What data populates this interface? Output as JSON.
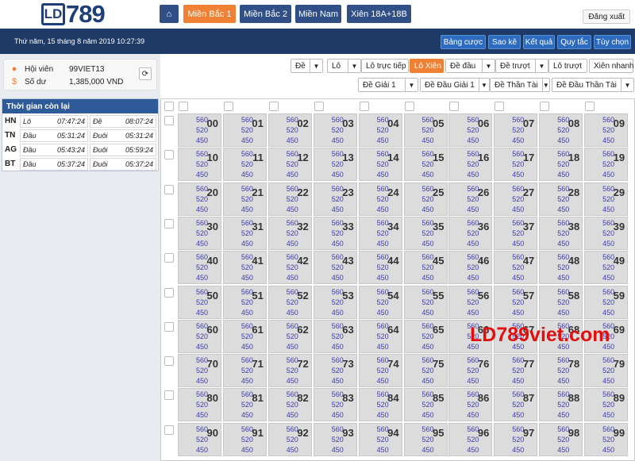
{
  "logo": {
    "mark": "LD",
    "number": "789"
  },
  "nav": {
    "home_icon": "home-icon",
    "items": [
      "Miền Bắc 1",
      "Miền Bắc 2",
      "Miền Nam",
      "Xiên 18A+18B"
    ],
    "active": 0
  },
  "logout": "Đăng xuất",
  "datetime": "Thứ năm, 15 tháng 8 năm 2019 10:27:39",
  "tools": [
    "Bảng cược",
    "Sao kê",
    "Kết quả",
    "Quy tắc",
    "Tùy chọn"
  ],
  "member": {
    "member_label": "Hội viên",
    "member_value": "99VIET13",
    "balance_label": "Số dư",
    "balance_value": "1,385,000 VND",
    "user_icon": "user-icon",
    "balance_icon": "dollar-icon",
    "refresh_icon": "refresh-icon"
  },
  "timer": {
    "title": "Thời gian còn lại",
    "rows": [
      {
        "region": "HN",
        "a_label": "Lô",
        "a_time": "07:47:24",
        "b_label": "Đề",
        "b_time": "08:07:24"
      },
      {
        "region": "TN",
        "a_label": "Đầu",
        "a_time": "05:31:24",
        "b_label": "Đuôi",
        "b_time": "05:31:24"
      },
      {
        "region": "AG",
        "a_label": "Đầu",
        "a_time": "05:43:24",
        "b_label": "Đuôi",
        "b_time": "05:59:24"
      },
      {
        "region": "BT",
        "a_label": "Đầu",
        "a_time": "05:37:24",
        "b_label": "Đuôi",
        "b_time": "05:37:24"
      }
    ]
  },
  "filters_row1": [
    {
      "label": "Đề",
      "dropdown": true
    },
    {
      "label": "Lô",
      "dropdown": true
    },
    {
      "label": "Lô trực tiếp",
      "dropdown": false
    },
    {
      "label": "Lô Xiên",
      "dropdown": false,
      "active": true
    },
    {
      "label": "Đề đầu",
      "dropdown": true
    },
    {
      "label": "Đề trượt",
      "dropdown": true
    },
    {
      "label": "Lô trượt",
      "dropdown": false
    },
    {
      "label": "Xiên nhanh",
      "dropdown": false
    }
  ],
  "filters_row2": [
    {
      "label": "Đề Giải 1",
      "dropdown": true
    },
    {
      "label": "Đề Đầu Giải 1",
      "dropdown": true
    },
    {
      "label": "Đề Thần Tài",
      "dropdown": true
    },
    {
      "label": "Đề Đầu Thần Tài",
      "dropdown": true
    }
  ],
  "odds": [
    "560",
    "520",
    "450"
  ],
  "numbers": [
    "00",
    "01",
    "02",
    "03",
    "04",
    "05",
    "06",
    "07",
    "08",
    "09",
    "10",
    "11",
    "12",
    "13",
    "14",
    "15",
    "16",
    "17",
    "18",
    "19",
    "20",
    "21",
    "22",
    "23",
    "24",
    "25",
    "26",
    "27",
    "28",
    "29",
    "30",
    "31",
    "32",
    "33",
    "34",
    "35",
    "36",
    "37",
    "38",
    "39",
    "40",
    "41",
    "42",
    "43",
    "44",
    "45",
    "46",
    "47",
    "48",
    "49",
    "50",
    "51",
    "52",
    "53",
    "54",
    "55",
    "56",
    "57",
    "58",
    "59",
    "60",
    "61",
    "62",
    "63",
    "64",
    "65",
    "66",
    "67",
    "68",
    "69",
    "70",
    "71",
    "72",
    "73",
    "74",
    "75",
    "76",
    "77",
    "78",
    "79",
    "80",
    "81",
    "82",
    "83",
    "84",
    "85",
    "86",
    "87",
    "88",
    "89",
    "90",
    "91",
    "92",
    "93",
    "94",
    "95",
    "96",
    "97",
    "98",
    "99"
  ],
  "watermark": "LD789viet.com",
  "colors": {
    "navy": "#1e3a66",
    "orange": "#f08033",
    "blue": "#2f4f86",
    "watermark": "#e01010"
  }
}
